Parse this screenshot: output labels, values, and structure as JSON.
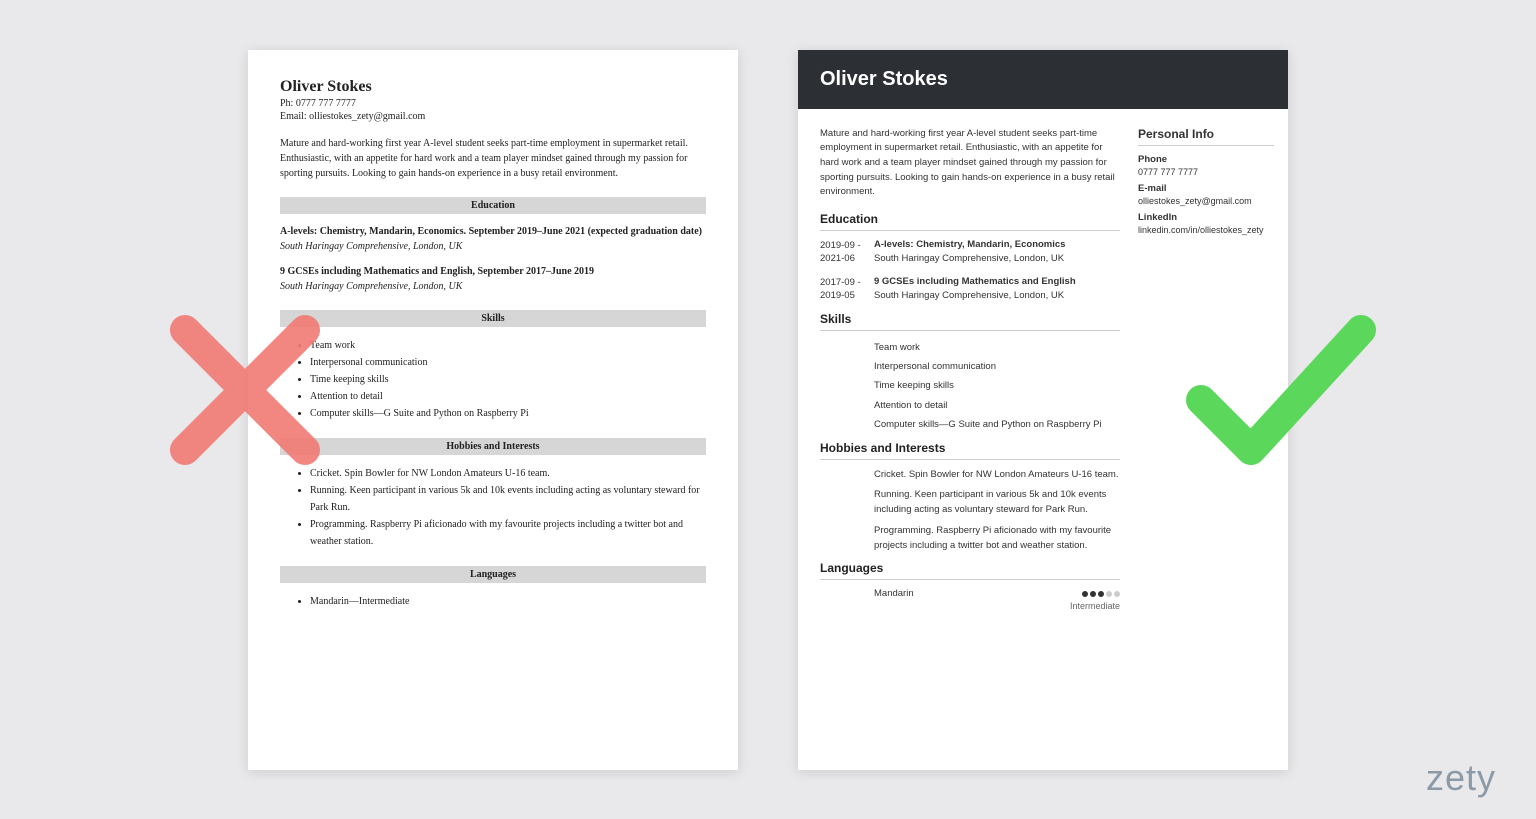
{
  "logo": "zety",
  "name": "Oliver Stokes",
  "left": {
    "phone_label": "Ph: 0777 777 7777",
    "email_label": "Email: olliestokes_zety@gmail.com",
    "summary": "Mature and hard-working first year A-level student seeks part-time employment in supermarket retail. Enthusiastic, with an appetite for hard work and a team player mindset gained through my passion for sporting pursuits. Looking to gain hands-on experience in a busy retail environment.",
    "sections": {
      "education": "Education",
      "skills": "Skills",
      "hobbies": "Hobbies and Interests",
      "languages": "Languages"
    },
    "edu1_title": "A-levels: Chemistry, Mandarin, Economics. September 2019–June 2021 (expected graduation date)",
    "edu1_sub": "South Haringay Comprehensive, London, UK",
    "edu2_title": "9 GCSEs including Mathematics and English, September 2017–June 2019",
    "edu2_sub": "South Haringay Comprehensive, London, UK",
    "skills": {
      "s1": "Team work",
      "s2": "Interpersonal communication",
      "s3": "Time keeping skills",
      "s4": "Attention to detail",
      "s5": "Computer skills—G Suite and Python on Raspberry Pi"
    },
    "hobbies": {
      "h1": "Cricket. Spin Bowler for NW London Amateurs U-16 team.",
      "h2": "Running. Keen participant in various 5k and 10k events including acting as voluntary steward for Park Run.",
      "h3": "Programming. Raspberry Pi aficionado with my favourite projects including a twitter bot and weather station."
    },
    "lang": "Mandarin—Intermediate"
  },
  "right": {
    "summary": "Mature and hard-working first year A-level student seeks part-time employment in supermarket retail. Enthusiastic, with an appetite for hard work and a team player mindset gained through my passion for sporting pursuits. Looking to gain hands-on experience in a busy retail environment.",
    "sections": {
      "education": "Education",
      "skills": "Skills",
      "hobbies": "Hobbies and Interests",
      "languages": "Languages"
    },
    "edu1_date": "2019-09 - 2021-06",
    "edu1_title": "A-levels: Chemistry, Mandarin, Economics",
    "edu1_sub": "South Haringay Comprehensive, London, UK",
    "edu2_date": "2017-09 - 2019-05",
    "edu2_title": "9 GCSEs including Mathematics and English",
    "edu2_sub": "South Haringay Comprehensive, London, UK",
    "skills": {
      "s1": "Team work",
      "s2": "Interpersonal communication",
      "s3": "Time keeping skills",
      "s4": "Attention to detail",
      "s5": "Computer skills—G Suite and Python on Raspberry Pi"
    },
    "hobbies": {
      "h1": "Cricket. Spin Bowler for NW London Amateurs U-16 team.",
      "h2": "Running. Keen participant in various 5k and 10k events including acting as voluntary steward for Park Run.",
      "h3": "Programming. Raspberry Pi aficionado with my favourite projects including a twitter bot and weather station."
    },
    "lang_name": "Mandarin",
    "lang_level": "Intermediate",
    "side": {
      "title": "Personal Info",
      "phone_label": "Phone",
      "phone": "0777 777 7777",
      "email_label": "E-mail",
      "email": "olliestokes_zety@gmail.com",
      "linkedin_label": "LinkedIn",
      "linkedin": "linkedin.com/in/olliestokes_zety"
    }
  }
}
